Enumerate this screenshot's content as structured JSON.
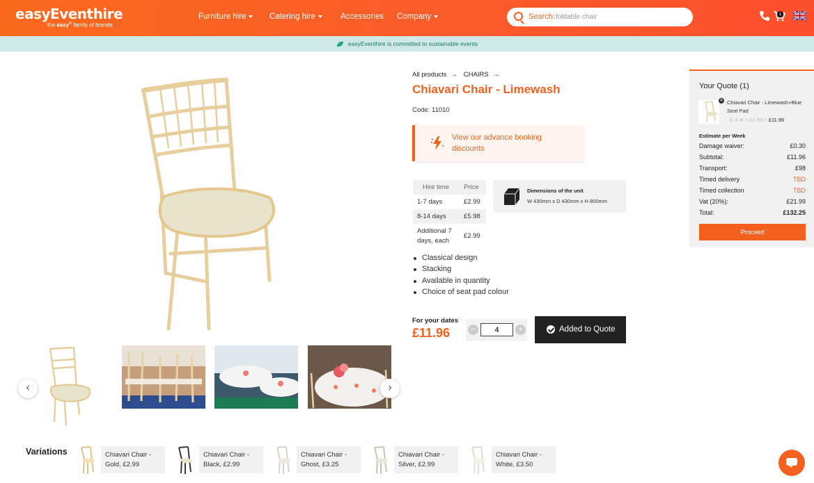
{
  "header": {
    "logo_main": "easyEventhire",
    "logo_sub_pre": "the",
    "logo_sub_bold": "easy",
    "logo_sub_post": "family of brands",
    "nav": [
      {
        "label": "Furniture hire",
        "dropdown": true
      },
      {
        "label": "Catering hire",
        "dropdown": true
      },
      {
        "label": "Accessories",
        "dropdown": false
      },
      {
        "label": "Company",
        "dropdown": true
      }
    ],
    "search_label": "Search:",
    "search_placeholder": "foldable chair",
    "cart_count": "1"
  },
  "eco_bar": {
    "text": "easyEventhire is committed to sustainable events"
  },
  "product": {
    "breadcrumb": [
      "All products",
      "CHAIRS"
    ],
    "title": "Chiavari Chair - Limewash",
    "code": "Code: 11010",
    "discount_text": "View our advance booking discounts",
    "price_table": {
      "headers": [
        "Hire time",
        "Price"
      ],
      "rows": [
        {
          "period": "1-7 days",
          "price": "£2.99"
        },
        {
          "period": "8-14 days",
          "price": "£5.98"
        },
        {
          "period": "Additional 7 days, each",
          "price": "£2.99"
        }
      ]
    },
    "dimensions": {
      "title": "Dimensions of the unit",
      "value": "W 430mm x D 430mm x H 800mm"
    },
    "features": [
      "Classical design",
      "Stacking",
      "Available in quantity",
      "Choice of seat pad colour"
    ],
    "for_dates_label": "For your dates",
    "price": "£11.96",
    "quantity": "4",
    "qty_minus": "−",
    "qty_plus": "+",
    "added_label": "Added to Quote"
  },
  "quote": {
    "title": "Your Quote (1)",
    "item_name": "Chiavari Chair - Limewash+Blue Seat Pad",
    "item_qty": "4",
    "item_unit": "£2.99",
    "item_total": "£11.96",
    "estimate_label": "Estimate per Week",
    "rows": [
      {
        "label": "Damage waiver:",
        "value": "£0.30",
        "tbd": false
      },
      {
        "label": "Subtotal:",
        "value": "£11.96",
        "tbd": false
      },
      {
        "label": "Transport:",
        "value": "£98",
        "tbd": false
      },
      {
        "label": "Timed delivery",
        "value": "TBD",
        "tbd": true
      },
      {
        "label": "Timed collection",
        "value": "TBD",
        "tbd": true
      },
      {
        "label": "Vat (20%):",
        "value": "£21.99",
        "tbd": false
      },
      {
        "label": "Total:",
        "value": "£132.25",
        "tbd": false
      }
    ],
    "proceed_label": "Proceed"
  },
  "variations": {
    "title": "Variations",
    "items": [
      {
        "line1": "Chiavari Chair -",
        "line2": "Gold, £2.99",
        "color": "#dcc58c"
      },
      {
        "line1": "Chiavari Chair -",
        "line2": "Black, £2.99",
        "color": "#3a3a3a"
      },
      {
        "line1": "Chiavari Chair -",
        "line2": "Ghost, £3.25",
        "color": "#e9e4da"
      },
      {
        "line1": "Chiavari Chair -",
        "line2": "Silver, £2.99",
        "color": "#cfcfcf"
      },
      {
        "line1": "Chiavari Chair -",
        "line2": "White, £3.50",
        "color": "#f0ece4"
      }
    ]
  },
  "colors": {
    "accent": "#f4611f",
    "dark": "#222222",
    "eco_bg": "#cfe9e6"
  }
}
